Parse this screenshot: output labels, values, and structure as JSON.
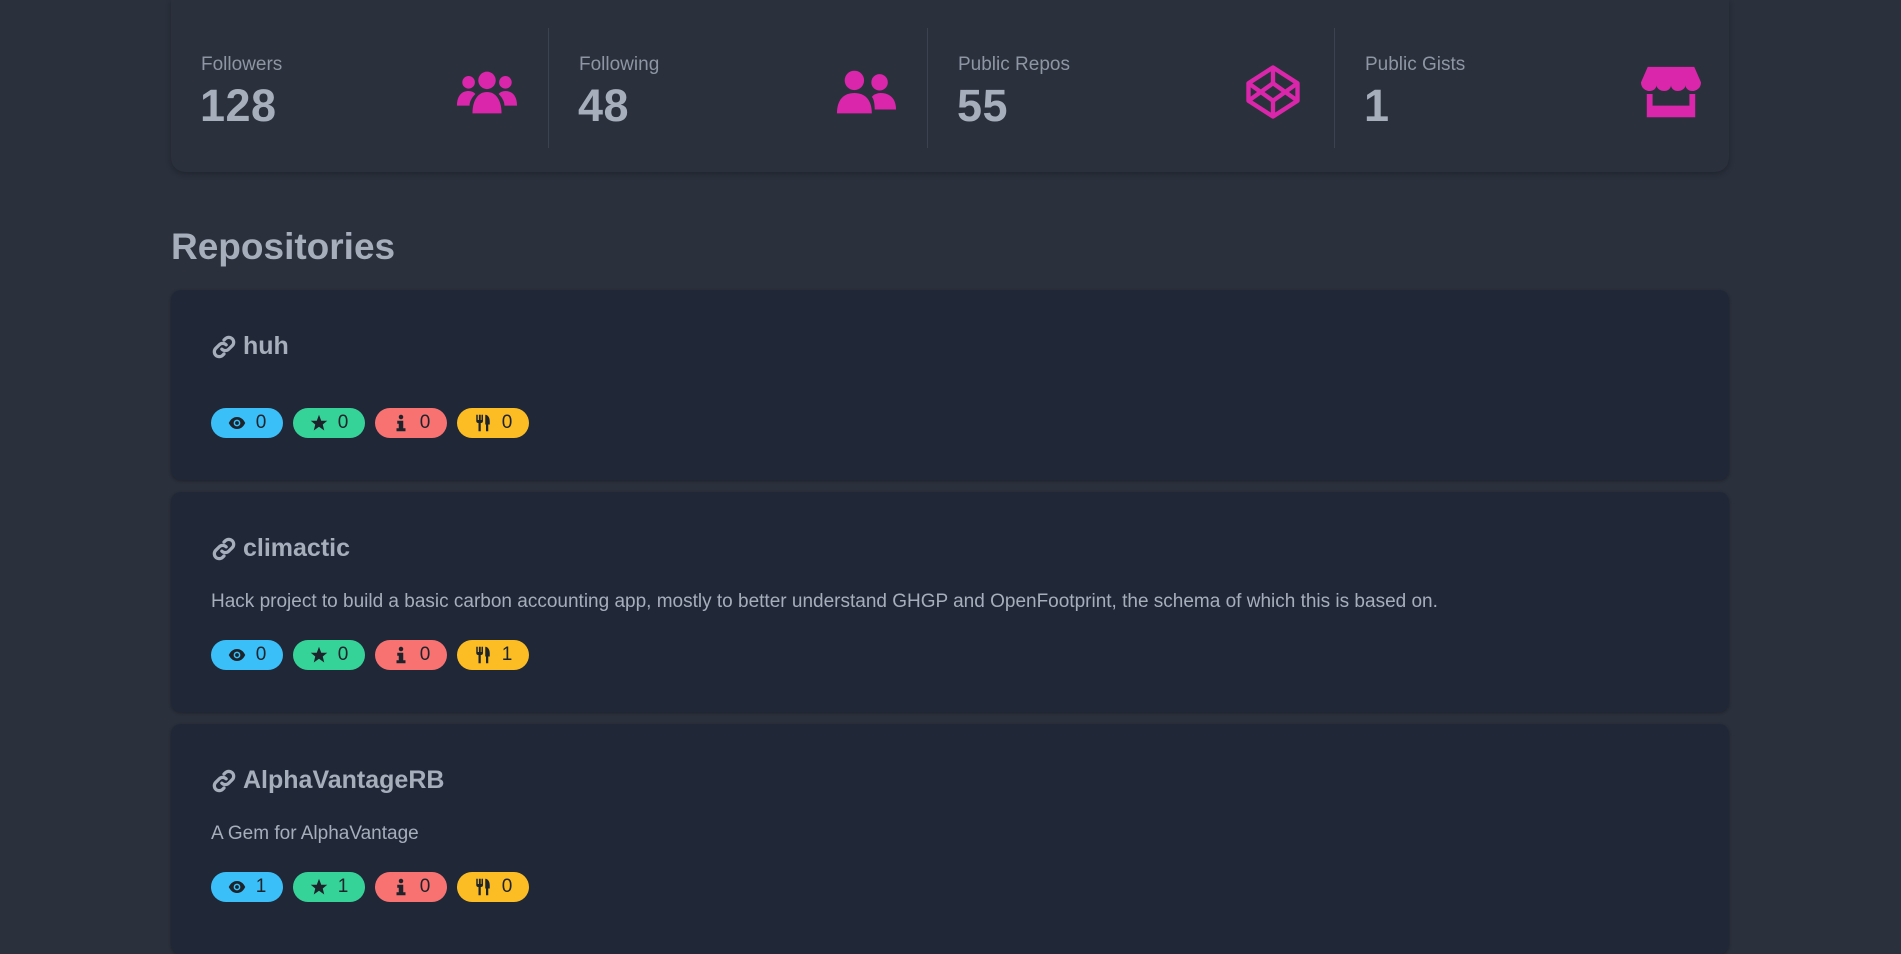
{
  "stats": [
    {
      "title": "Followers",
      "value": "128",
      "icon": "users-icon"
    },
    {
      "title": "Following",
      "value": "48",
      "icon": "user-friends-icon"
    },
    {
      "title": "Public Repos",
      "value": "55",
      "icon": "codepen-icon"
    },
    {
      "title": "Public Gists",
      "value": "1",
      "icon": "store-icon"
    }
  ],
  "colors": {
    "accent": "#d926aa",
    "info": "#3abff8",
    "success": "#36d399",
    "error": "#f87272",
    "warning": "#fbbd23",
    "card": "#202838",
    "background": "#2a303c"
  },
  "repositories_title": "Repositories",
  "repositories": [
    {
      "name": "huh",
      "description": "",
      "watchers": "0",
      "stars": "0",
      "issues": "0",
      "forks": "0"
    },
    {
      "name": "climactic",
      "description": "Hack project to build a basic carbon accounting app, mostly to better understand GHGP and OpenFootprint, the schema of which this is based on.",
      "watchers": "0",
      "stars": "0",
      "issues": "0",
      "forks": "1"
    },
    {
      "name": "AlphaVantageRB",
      "description": "A Gem for AlphaVantage",
      "watchers": "1",
      "stars": "1",
      "issues": "0",
      "forks": "0"
    }
  ]
}
